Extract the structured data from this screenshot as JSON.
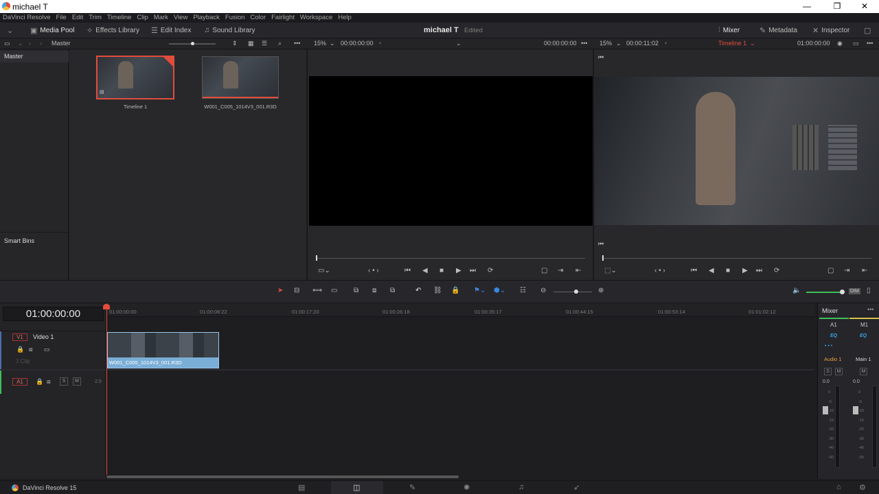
{
  "window": {
    "title": "michael T",
    "minimize": "—",
    "maximize": "❐",
    "close": "✕"
  },
  "menu": [
    "DaVinci Resolve",
    "File",
    "Edit",
    "Trim",
    "Timeline",
    "Clip",
    "Mark",
    "View",
    "Playback",
    "Fusion",
    "Color",
    "Fairlight",
    "Workspace",
    "Help"
  ],
  "toolbar": {
    "media_pool": "Media Pool",
    "effects_library": "Effects Library",
    "edit_index": "Edit Index",
    "sound_library": "Sound Library",
    "project_name": "michael T",
    "project_status": "Edited",
    "mixer": "Mixer",
    "metadata": "Metadata",
    "inspector": "Inspector"
  },
  "subbar": {
    "bin_name": "Master",
    "src_zoom": "15%",
    "src_tc": "00:00:00:00",
    "src_tc_right": "00:00:00:00",
    "tl_zoom": "15%",
    "tl_duration": "00:00:11:02",
    "timeline_name": "Timeline 1",
    "tl_tc": "01:00:00:00"
  },
  "bins": {
    "master": "Master",
    "smart_bins": "Smart Bins"
  },
  "clips": [
    {
      "name": "Timeline 1"
    },
    {
      "name": "W001_C005_1014V3_001.R3D"
    }
  ],
  "timecode": "01:00:00:00",
  "ruler": [
    "01:00:00:00",
    "01:00:08:22",
    "01:00:17:20",
    "01:00:26:18",
    "01:00:35:17",
    "01:00:44:15",
    "01:00:53:14",
    "01:01:02:12"
  ],
  "tracks": {
    "v1_tag": "V1",
    "v1_name": "Video 1",
    "v1_count": "1 Clip",
    "a1_tag": "A1",
    "a1_level": "2.0",
    "clip_name": "W001_C005_1014V3_001.R3D",
    "s": "S",
    "m": "M"
  },
  "mixer": {
    "title": "Mixer",
    "ch1": "A1",
    "ch2": "M1",
    "eq": "EQ",
    "audio1": "Audio 1",
    "main1": "Main 1",
    "level1": "0.0",
    "level2": "0.0",
    "scale": [
      "0",
      "-5",
      "-10",
      "-15",
      "-20",
      "-30",
      "-40",
      "-50"
    ]
  },
  "status": {
    "app": "DaVinci Resolve 15"
  },
  "colors": {
    "accent": "#e24d3b",
    "clip": "#7aaed6",
    "audio_green": "#3fbf5a"
  }
}
